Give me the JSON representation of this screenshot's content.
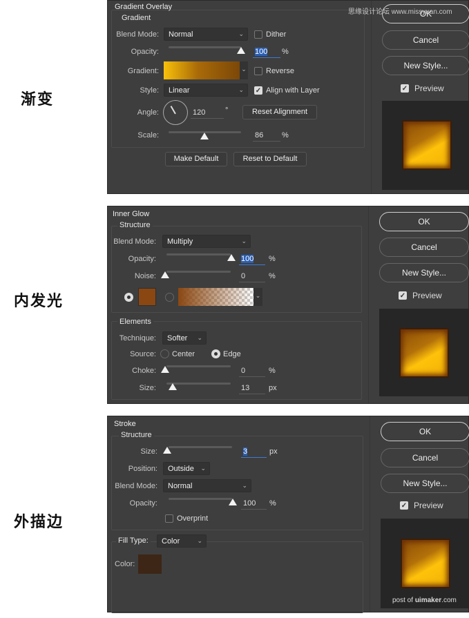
{
  "captions": {
    "gradient": "渐变",
    "inner_glow": "内发光",
    "stroke": "外描边"
  },
  "watermarks": {
    "top": "思缘设计论坛 www.missyuan.com",
    "bottom_prefix": "post of ",
    "bottom_brand": "uimaker",
    "bottom_suffix": ".com"
  },
  "common": {
    "ok": "OK",
    "cancel": "Cancel",
    "new_style": "New Style...",
    "preview": "Preview",
    "preview_checked": true,
    "chevron": "⌄",
    "check": "✓"
  },
  "gradient_overlay": {
    "title": "Gradient Overlay",
    "group": "Gradient",
    "blend_mode_label": "Blend Mode:",
    "blend_mode": "Normal",
    "dither_label": "Dither",
    "dither": false,
    "opacity_label": "Opacity:",
    "opacity": "100",
    "opacity_unit": "%",
    "gradient_label": "Gradient:",
    "gradient_colors": [
      "#f9c10a",
      "#7c4708"
    ],
    "reverse_label": "Reverse",
    "reverse": false,
    "style_label": "Style:",
    "style": "Linear",
    "align_label": "Align with Layer",
    "align": true,
    "angle_label": "Angle:",
    "angle": "120",
    "angle_unit": "°",
    "reset_alignment": "Reset Alignment",
    "scale_label": "Scale:",
    "scale": "86",
    "scale_unit": "%",
    "make_default": "Make Default",
    "reset_default": "Reset to Default"
  },
  "inner_glow": {
    "title": "Inner Glow",
    "group": "Structure",
    "blend_mode_label": "Blend Mode:",
    "blend_mode": "Multiply",
    "opacity_label": "Opacity:",
    "opacity": "100",
    "opacity_unit": "%",
    "noise_label": "Noise:",
    "noise": "0",
    "noise_unit": "%",
    "color": "#8a4712",
    "fill_mode": "color",
    "elements_group": "Elements",
    "technique_label": "Technique:",
    "technique": "Softer",
    "source_label": "Source:",
    "source_center": "Center",
    "source_edge": "Edge",
    "source": "Edge",
    "choke_label": "Choke:",
    "choke": "0",
    "choke_unit": "%",
    "size_label": "Size:",
    "size": "13",
    "size_unit": "px"
  },
  "stroke": {
    "title": "Stroke",
    "group": "Structure",
    "size_label": "Size:",
    "size": "3",
    "size_unit": "px",
    "position_label": "Position:",
    "position": "Outside",
    "blend_mode_label": "Blend Mode:",
    "blend_mode": "Normal",
    "opacity_label": "Opacity:",
    "opacity": "100",
    "opacity_unit": "%",
    "overprint_label": "Overprint",
    "overprint": false,
    "fill_type_label": "Fill Type:",
    "fill_type": "Color",
    "color_label": "Color:",
    "color": "#3d2616"
  }
}
